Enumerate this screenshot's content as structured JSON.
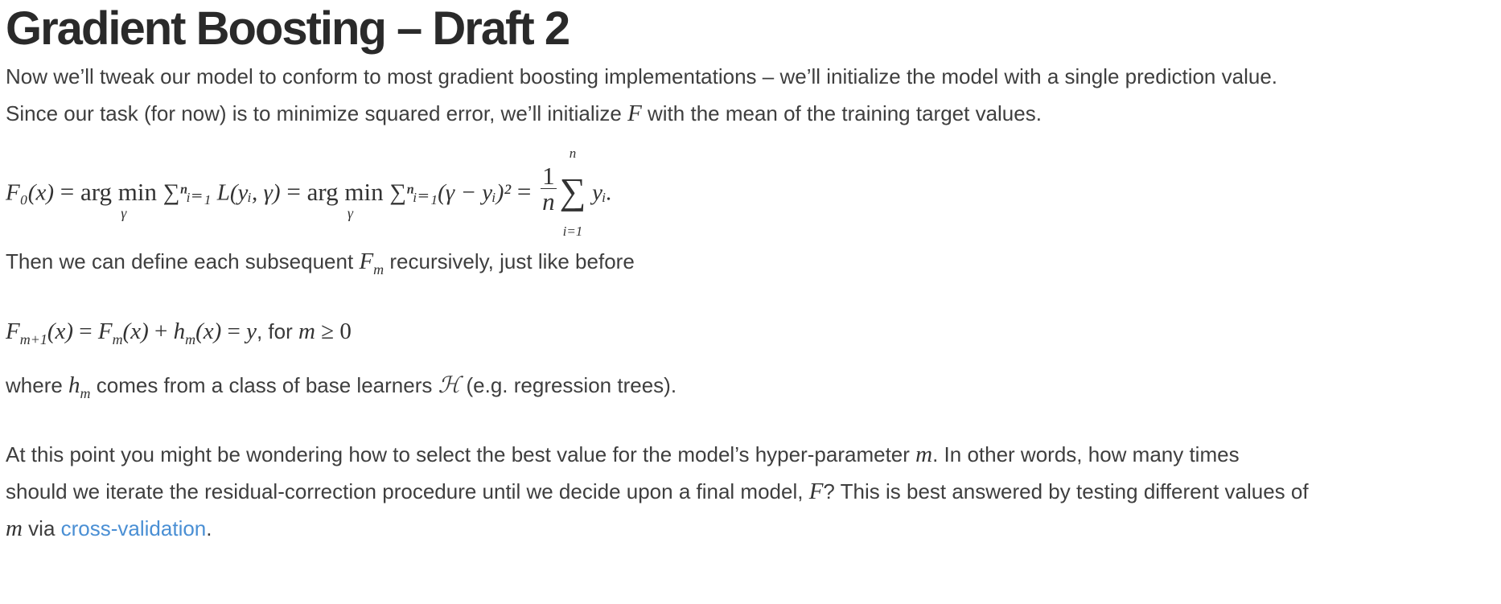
{
  "title": "Gradient Boosting – Draft 2",
  "para1": {
    "line1": "Now we’ll tweak our model to conform to most gradient boosting implementations – we’ll initialize the model with a single prediction value.",
    "line2_before": "Since our task (for now) is to minimize squared error, we’ll initialize ",
    "line2_var": "F",
    "line2_after": " with the mean of the training target values."
  },
  "equation1": {
    "lhs": "F₀(x)",
    "eq": "=",
    "argmin": "arg min",
    "argmin_sub": "γ",
    "sum1": "∑ⁿᵢ₌₁ L(yᵢ, γ)",
    "sum2": "∑ⁿᵢ₌₁(γ − yᵢ)²",
    "frac_num": "1",
    "frac_den": "n",
    "bigsum_top": "n",
    "bigsum_bot": "i=1",
    "tail": "yᵢ."
  },
  "para2": {
    "before": "Then we can define each subsequent ",
    "var": "Fm",
    "after": " recursively, just like before"
  },
  "equation2": {
    "expr": "F",
    "text_for": "for"
  },
  "para3": {
    "before": "where ",
    "var": "hm",
    "middle": " comes from a class of base learners ",
    "calH": "ℋ",
    "after": " (e.g. regression trees)."
  },
  "para4": {
    "line1_before": "At this point you might be wondering how to select the best value for the model’s hyper-parameter ",
    "line1_var": "m",
    "line1_after": ". In other words, how many times",
    "line2_before": "should we iterate the residual-correction procedure until we decide upon a final model, ",
    "line2_var": "F",
    "line2_after": "? This is best answered by testing different values of",
    "line3_var": "m",
    "line3_middle": " via ",
    "link_text": "cross-validation",
    "line3_after": "."
  },
  "colors": {
    "link": "#4a8fd4",
    "text": "#3e3e3e",
    "heading": "#2a2a2a"
  }
}
